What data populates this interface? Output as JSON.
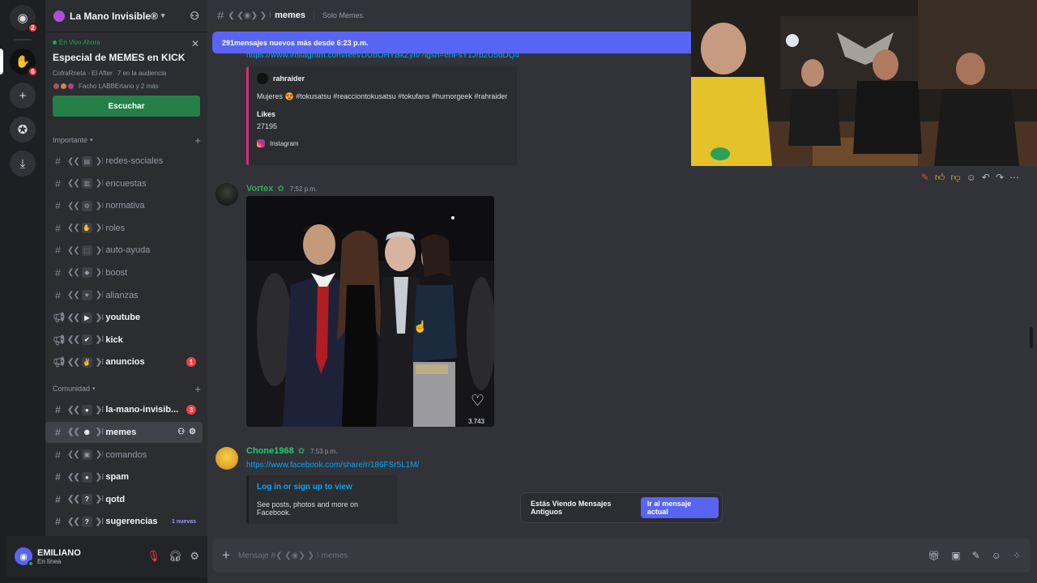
{
  "server": {
    "name": "La Mano Invisible®"
  },
  "rail": {
    "home_badge": "2",
    "server_badge": "6"
  },
  "live": {
    "status": "En Vivo Ahora",
    "title": "Especial de MEMES en KICK",
    "host": "CofraRneta - El After",
    "audience": "7 en la audiencia",
    "people": "Facho LABBErtario y 2 más",
    "listen_label": "Escuchar"
  },
  "categories": {
    "important": "Importante",
    "community": "Comunidad"
  },
  "channels_important": [
    {
      "name": "redes-sociales",
      "emoji": "▤",
      "bold": false
    },
    {
      "name": "encuestas",
      "emoji": "▥",
      "bold": false
    },
    {
      "name": "normativa",
      "emoji": "⚙",
      "bold": false
    },
    {
      "name": "roles",
      "emoji": "✋",
      "bold": false
    },
    {
      "name": "auto-ayuda",
      "emoji": "⬚",
      "bold": false
    },
    {
      "name": "boost",
      "emoji": "◆",
      "bold": false
    },
    {
      "name": "alianzas",
      "emoji": "♥",
      "bold": false
    },
    {
      "name": "youtube",
      "emoji": "▶",
      "bold": true
    },
    {
      "name": "kick",
      "emoji": "✔",
      "bold": true
    },
    {
      "name": "anuncios",
      "emoji": "✌",
      "bold": true,
      "badge": "1"
    }
  ],
  "channels_community": [
    {
      "name": "la-mano-invisib...",
      "emoji": "●",
      "bold": true,
      "badge": "3"
    },
    {
      "name": "memes",
      "emoji": "◉",
      "bold": true,
      "active": true
    },
    {
      "name": "comandos",
      "emoji": "▣",
      "bold": false
    },
    {
      "name": "spam",
      "emoji": "●",
      "bold": true
    },
    {
      "name": "qotd",
      "emoji": "?",
      "bold": true
    },
    {
      "name": "sugerencias",
      "emoji": "?",
      "bold": true,
      "new_label": "1 nuevas"
    }
  ],
  "user": {
    "name": "EMILIANO",
    "status": "En línea"
  },
  "header": {
    "channel": "memes",
    "topic": "Solo Memes."
  },
  "new_messages_bar": "291mensajes nuevos más desde 6:23 p.m.",
  "messages": {
    "first_link": "https://www.instagram.com/reel/DUbOHYBkZyn/?igsh=enFsY1Jrb2U5dDQ4",
    "ig_embed": {
      "author": "rahraider",
      "description": "Mujeres 😍 #tokusatsu #reacciontokusatsu #tokufans #humorgeek #rahraider",
      "field_name": "Likes",
      "field_value": "27195",
      "footer": "Instagram"
    },
    "vortex": {
      "user": "Vortex",
      "time": "7:52 p.m.",
      "photo_count": "3.743"
    },
    "chone": {
      "user": "Chone1968",
      "time": "7:53 p.m.",
      "link": "https://www.facebook.com/share/r/186FSr5L1M/",
      "embed_title": "Log in or sign up to view",
      "embed_text": "See posts, photos and more on Facebook."
    }
  },
  "old_messages": {
    "text": "Estás Viendo Mensajes Antiguos",
    "button": "Ir al mensaje actual"
  },
  "composer": {
    "placeholder": "Mensaje #❮ ❮◉❯ ❯ ⁝ memes"
  },
  "colors": {
    "accent": "#5865f2",
    "green": "#23a55a",
    "vortex_name": "#3ba55c",
    "chone_name": "#2dc770",
    "link": "#00a8fc",
    "danger": "#f23f43"
  },
  "icons": [
    "discord-icon",
    "server-icon",
    "add-server-icon",
    "explore-icon",
    "download-icon",
    "invite-icon",
    "close-icon",
    "headphones-icon",
    "microphone-muted-icon",
    "gear-icon",
    "speaker-icon",
    "hash-icon",
    "thumbs-up-icon",
    "thumbs-down-icon",
    "reply-icon",
    "forward-icon",
    "more-icon",
    "heart-icon",
    "gift-icon",
    "gif-icon",
    "sticker-icon",
    "emoji-icon",
    "apps-icon"
  ]
}
